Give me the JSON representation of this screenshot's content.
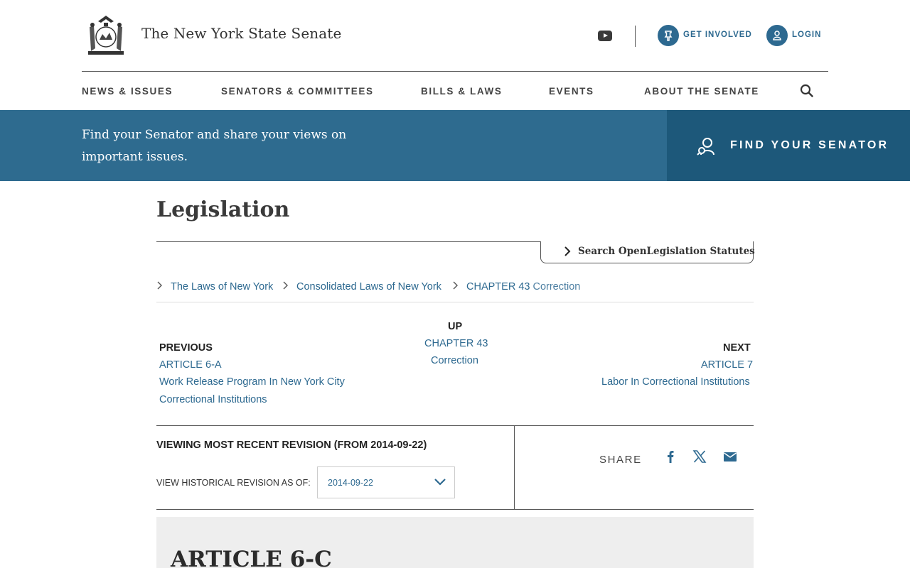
{
  "header": {
    "site_title": "The New York State Senate",
    "get_involved": "GET INVOLVED",
    "login": "LOGIN"
  },
  "nav": {
    "items": [
      "NEWS & ISSUES",
      "SENATORS & COMMITTEES",
      "BILLS & LAWS",
      "EVENTS",
      "ABOUT THE SENATE"
    ]
  },
  "banner": {
    "text": "Find your Senator and share your views on important issues.",
    "button": "FIND YOUR SENATOR"
  },
  "main": {
    "title": "Legislation",
    "search_statutes": "Search OpenLegislation Statutes",
    "breadcrumb": {
      "laws": "The Laws of New York",
      "consolidated": "Consolidated Laws of New York",
      "chapter": "CHAPTER 43",
      "chapter_name": "Correction"
    },
    "pager": {
      "previous_label": "PREVIOUS",
      "previous_article": "ARTICLE 6-A",
      "previous_title_1": "Work Release Program In New York City",
      "previous_title_2": "Correctional Institutions",
      "up_label": "UP",
      "up_chapter": "CHAPTER 43",
      "up_title": "Correction",
      "next_label": "NEXT",
      "next_article": "ARTICLE 7",
      "next_title": "Labor In Correctional Institutions"
    },
    "revision": {
      "title": "VIEWING MOST RECENT REVISION (FROM 2014-09-22)",
      "label": "VIEW HISTORICAL REVISION AS OF:",
      "selected": "2014-09-22"
    },
    "share_label": "SHARE",
    "article_title": "ARTICLE 6-C"
  },
  "colors": {
    "brand_blue": "#2d6990",
    "banner": "#2e6b8f",
    "banner_dark": "#1d587a"
  },
  "icons": [
    "nys-seal-icon",
    "youtube-icon",
    "pin-icon",
    "user-icon",
    "search-icon",
    "find-senator-icon",
    "facebook-icon",
    "x-icon",
    "mail-icon"
  ]
}
